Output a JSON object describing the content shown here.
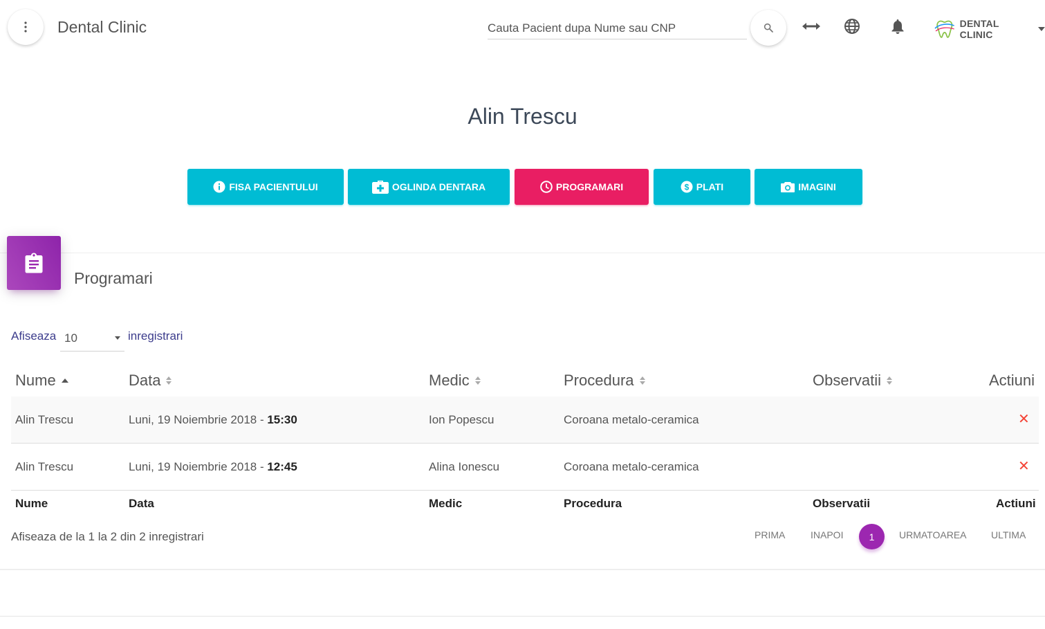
{
  "topbar": {
    "brand": "Dental Clinic",
    "search_placeholder": "Cauta Pacient dupa Nume sau CNP",
    "user_name": "DENTAL CLINIC"
  },
  "patient": {
    "name": "Alin Trescu"
  },
  "nav": [
    {
      "label": "FISA PACIENTULUI",
      "icon": "info-icon",
      "color": "#00bcd4"
    },
    {
      "label": "OGLINDA DENTARA",
      "icon": "medical-bag-icon",
      "color": "#00bcd4"
    },
    {
      "label": "PROGRAMARI",
      "icon": "clock-icon",
      "color": "#e91e63",
      "active": true
    },
    {
      "label": "PLATI",
      "icon": "dollar-icon",
      "color": "#00bcd4"
    },
    {
      "label": "IMAGINI",
      "icon": "camera-icon",
      "color": "#00bcd4"
    }
  ],
  "card": {
    "title": "Programari",
    "icon": "clipboard-icon",
    "accent": "#9c27b0"
  },
  "length": {
    "prefix": "Afiseaza",
    "value": "10",
    "suffix": "inregistrari"
  },
  "table": {
    "headers": [
      "Nume",
      "Data",
      "Medic",
      "Procedura",
      "Observatii",
      "Actiuni"
    ],
    "rows": [
      {
        "nume": "Alin Trescu",
        "data": "Luni, 19 Noiembrie 2018 - ",
        "ora": "15:30",
        "medic": "Ion Popescu",
        "procedura": "Coroana metalo-ceramica",
        "observatii": "",
        "action": "✕"
      },
      {
        "nume": "Alin Trescu",
        "data": "Luni, 19 Noiembrie 2018 - ",
        "ora": "12:45",
        "medic": "Alina Ionescu",
        "procedura": "Coroana metalo-ceramica",
        "observatii": "",
        "action": "✕"
      }
    ],
    "footer": [
      "Nume",
      "Data",
      "Medic",
      "Procedura",
      "Observatii",
      "Actiuni"
    ]
  },
  "info": "Afiseaza de la 1 la 2 din 2 inregistrari",
  "pagination": {
    "first": "PRIMA",
    "prev": "INAPOI",
    "current": "1",
    "next": "URMATOAREA",
    "last": "ULTIMA"
  }
}
